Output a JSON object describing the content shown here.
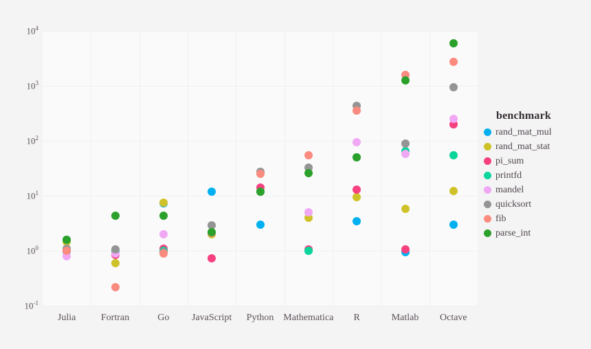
{
  "chart_data": {
    "type": "scatter",
    "title": "",
    "xlabel": "",
    "ylabel": "",
    "yscale": "log",
    "ylim": [
      0.1,
      10000
    ],
    "grid": true,
    "legend_position": "right",
    "legend_title": "benchmark",
    "categories": [
      "Julia",
      "Fortran",
      "Go",
      "JavaScript",
      "Python",
      "Mathematica",
      "R",
      "Matlab",
      "Octave"
    ],
    "y_ticks": [
      {
        "label_base": "10",
        "label_exp": "4",
        "value": 10000
      },
      {
        "label_base": "10",
        "label_exp": "3",
        "value": 1000
      },
      {
        "label_base": "10",
        "label_exp": "2",
        "value": 100
      },
      {
        "label_base": "10",
        "label_exp": "1",
        "value": 10
      },
      {
        "label_base": "10",
        "label_exp": "0",
        "value": 1
      },
      {
        "label_base": "10",
        "label_exp": "-1",
        "value": 0.1
      }
    ],
    "series": [
      {
        "name": "rand_mat_mul",
        "color": "#00b0f0",
        "values": [
          0.98,
          0.95,
          7.3,
          12.0,
          3.0,
          1.0,
          3.4,
          0.95,
          3.0
        ]
      },
      {
        "name": "rand_mat_stat",
        "color": "#cfc229",
        "values": [
          1.45,
          0.6,
          7.5,
          2.0,
          11.8,
          4.0,
          9.5,
          5.8,
          12.3
        ]
      },
      {
        "name": "pi_sum",
        "color": "#f6407f",
        "values": [
          1.0,
          0.85,
          1.1,
          0.72,
          14.0,
          1.05,
          13.0,
          1.05,
          200.0
        ]
      },
      {
        "name": "printfd",
        "color": "#0ad59a",
        "values": [
          1.6,
          1.0,
          1.0,
          2.1,
          12.0,
          1.0,
          50.0,
          65.0,
          55.0
        ]
      },
      {
        "name": "mandel",
        "color": "#f0a8f5",
        "values": [
          0.8,
          0.9,
          2.0,
          2.1,
          12.0,
          5.0,
          95.0,
          58.0,
          250.0
        ]
      },
      {
        "name": "quicksort",
        "color": "#949494",
        "values": [
          1.1,
          1.05,
          0.95,
          2.9,
          27.0,
          33.0,
          430.0,
          90.0,
          950.0
        ]
      },
      {
        "name": "fib",
        "color": "#fb8a7f",
        "values": [
          1.0,
          0.22,
          0.9,
          2.1,
          25.0,
          55.0,
          350.0,
          1600.0,
          2700.0
        ]
      },
      {
        "name": "parse_int",
        "color": "#2ba02b",
        "values": [
          1.6,
          4.3,
          4.3,
          2.2,
          12.0,
          26.0,
          50.0,
          1250.0,
          6000.0
        ]
      }
    ]
  }
}
